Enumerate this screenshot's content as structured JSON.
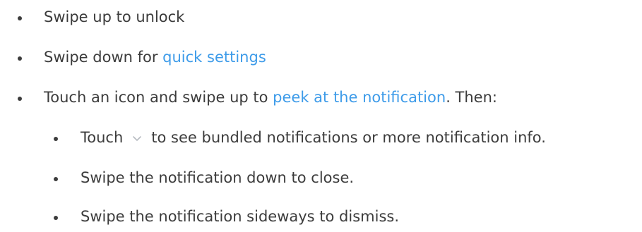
{
  "items": [
    {
      "text": "Swipe up to unlock"
    },
    {
      "prefix": "Swipe down for ",
      "link": "quick settings"
    },
    {
      "prefix": "Touch an icon and swipe up to ",
      "link": "peek at the notification",
      "suffix": ". Then:"
    }
  ],
  "subitems": [
    {
      "prefix": "Touch",
      "icon": "chevron-down-icon",
      "suffix": "to see bundled notifications or more notification info."
    },
    {
      "text": "Swipe the notification down to close."
    },
    {
      "text": "Swipe the notification sideways to dismiss."
    }
  ],
  "colors": {
    "text": "#3c3c3c",
    "link": "#3d9be9",
    "icon": "#b8bcc2"
  }
}
